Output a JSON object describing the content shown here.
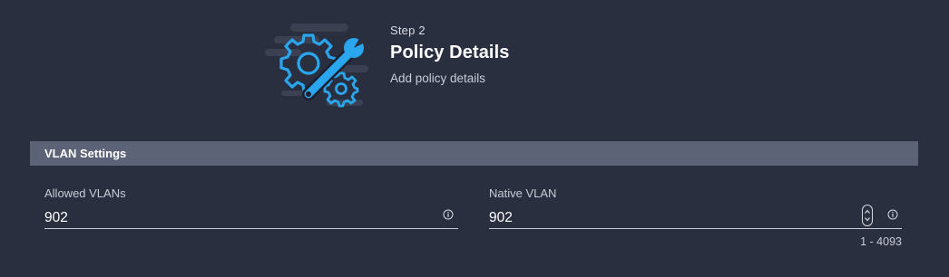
{
  "header": {
    "step_label": "Step 2",
    "title": "Policy Details",
    "subtitle": "Add policy details",
    "illustration_icon": "gear-wrench-icon"
  },
  "section": {
    "title": "VLAN Settings"
  },
  "fields": {
    "allowed_vlans": {
      "label": "Allowed VLANs",
      "value": "902",
      "info_icon": "info-icon"
    },
    "native_vlan": {
      "label": "Native VLAN",
      "value": "902",
      "info_icon": "info-icon",
      "stepper_icon": "stepper-icon",
      "hint": "1 - 4093"
    }
  },
  "colors": {
    "background": "#2a2f40",
    "section_bar": "#5d6376",
    "accent": "#2aa6ee",
    "text": "#ffffff"
  }
}
